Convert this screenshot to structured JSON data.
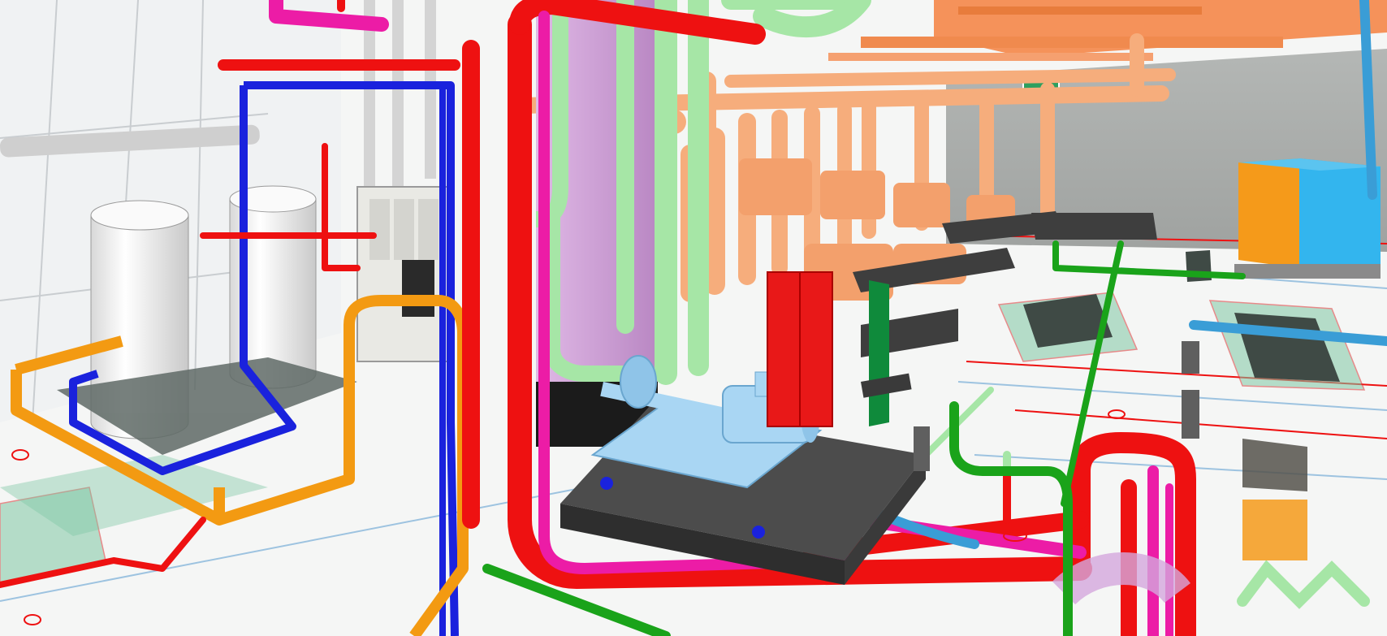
{
  "scene": {
    "description_hidden": "",
    "exit_sign_icon": "exit-sign-icon",
    "colors": {
      "background": "#eef0ef",
      "floor": "#f7f8f7",
      "wall_gray": "#a7aaa8",
      "red_pipe": "#ee1111",
      "blue_pipe": "#1a22dd",
      "orange_pipe": "#f39a12",
      "magenta_pipe": "#ec1ca6",
      "light_green_pipe": "#a6e6a6",
      "dark_green_pipe": "#1aa31a",
      "salmon_pipe": "#f6ad7c",
      "orange_duct": "#f5925a",
      "lavender_duct": "#d5a8dd",
      "light_blue_pump": "#a9d6f3",
      "skid_gray": "#4c4c4c",
      "tank_white": "#f2f2f2",
      "cabinet_orange": "#f59a1a",
      "cabinet_blue": "#33b5ee",
      "exit_sign_green": "#2e9f5f",
      "translucent_box": "#7fc7a5",
      "cyan_pipe": "#3a9dd6",
      "steel_pipe": "#cfcfcf"
    }
  }
}
